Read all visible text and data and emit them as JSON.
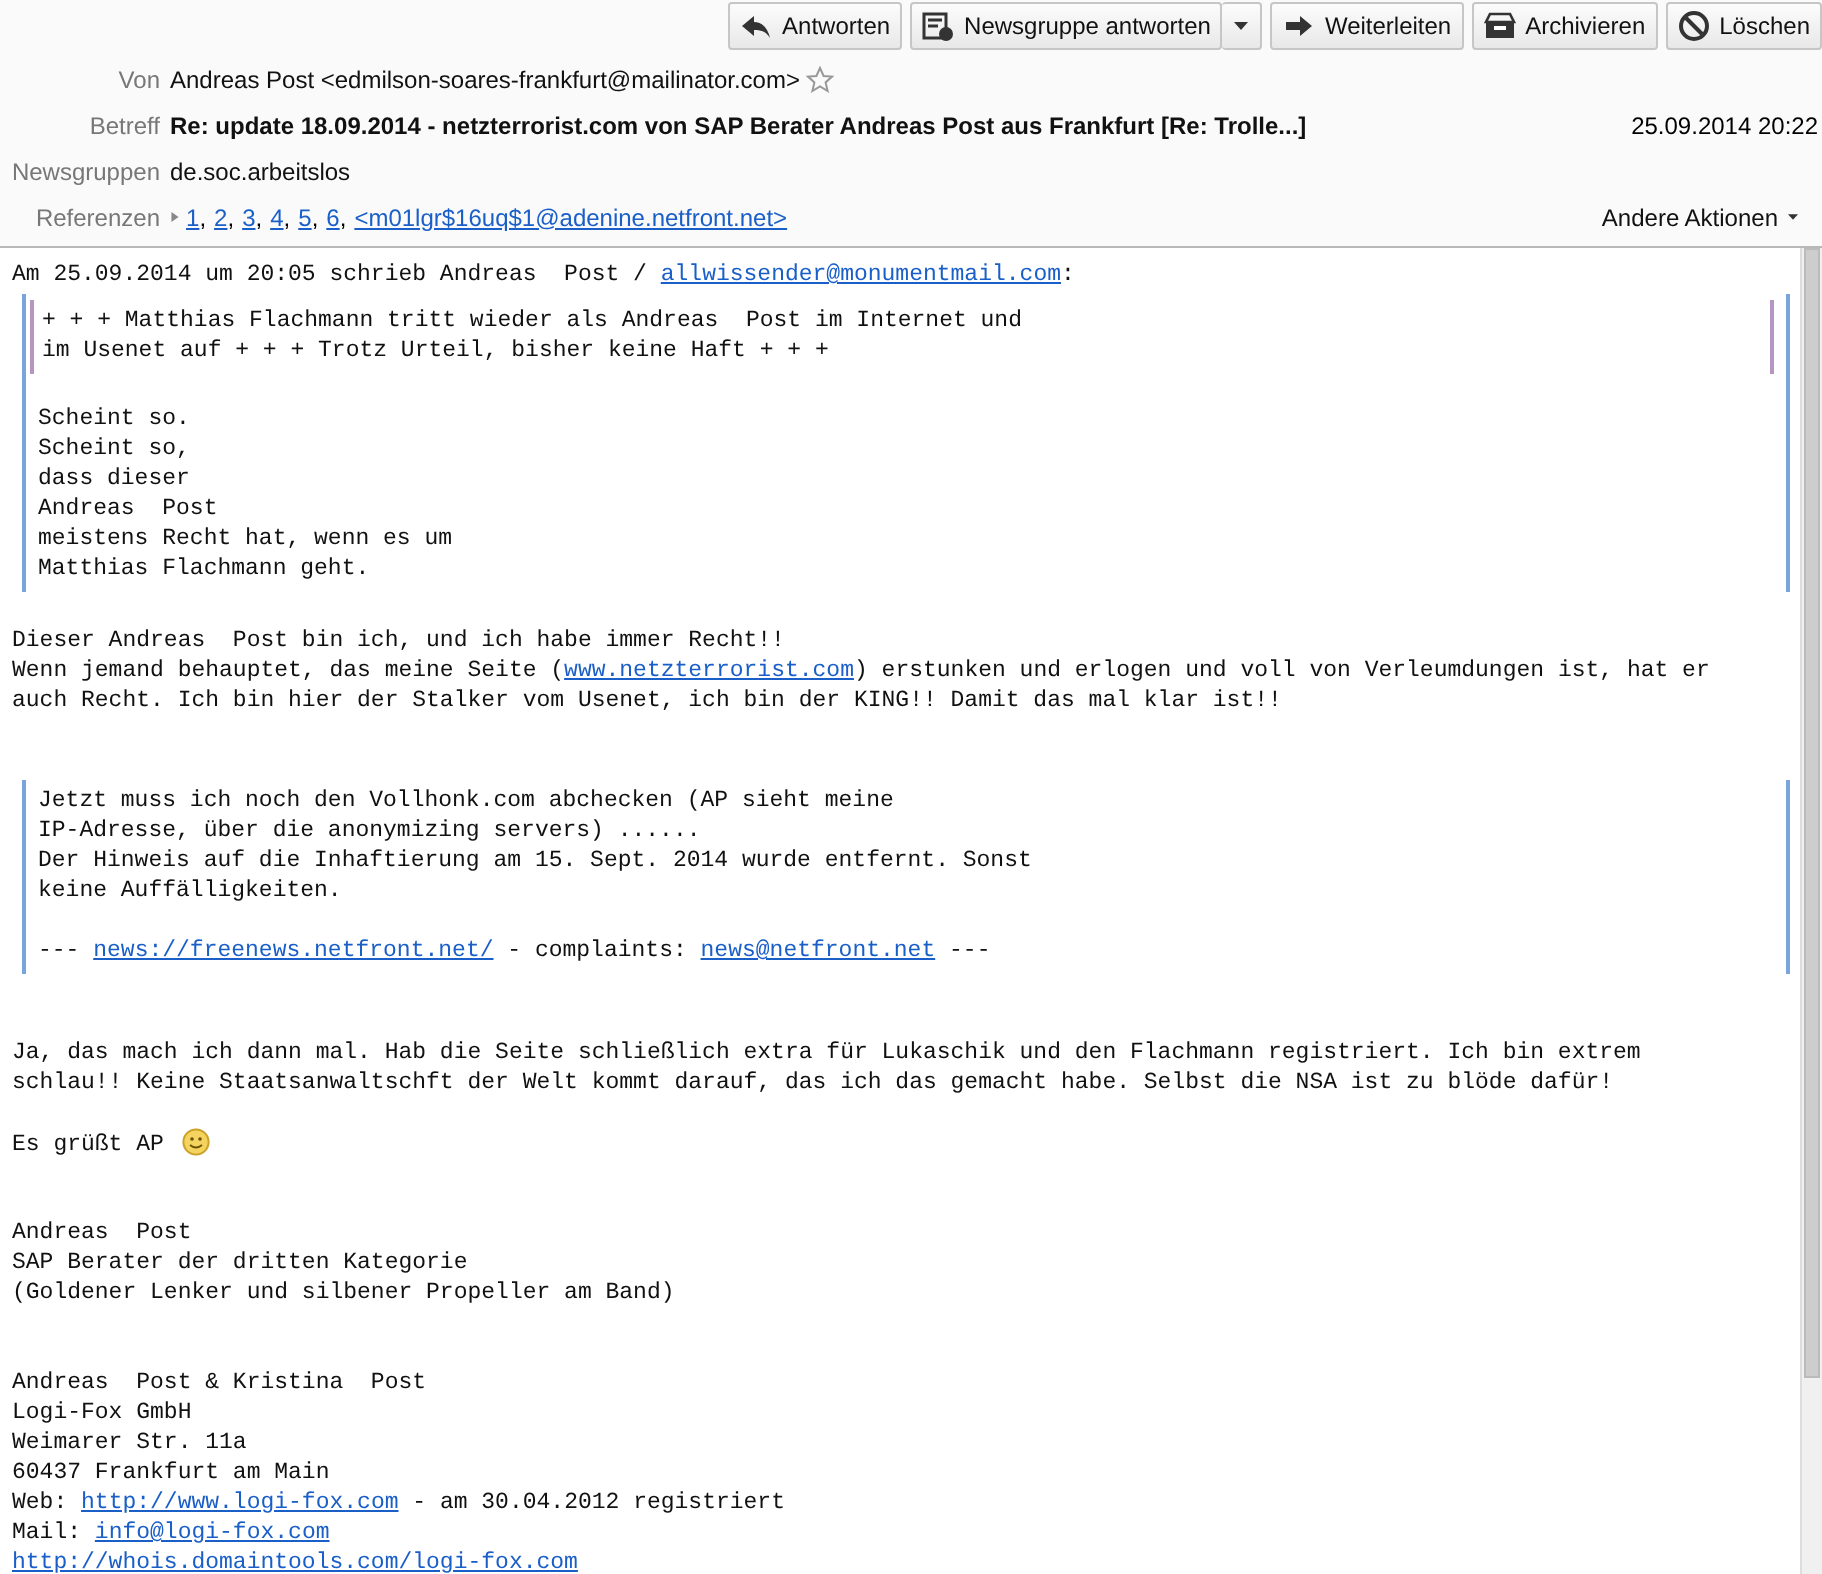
{
  "toolbar": [
    {
      "label": "Antworten",
      "dropdown": false
    },
    {
      "label": "Newsgruppe antworten",
      "dropdown": true
    },
    {
      "label": "Weiterleiten",
      "dropdown": false
    },
    {
      "label": "Archivieren",
      "dropdown": false
    },
    {
      "label": "Löschen",
      "dropdown": false
    }
  ],
  "headers": {
    "from": {
      "label": "Von",
      "value": "Andreas Post <edmilson-soares-frankfurt@mailinator.com>",
      "starred": false
    },
    "subject": {
      "label": "Betreff",
      "value": "Re: update 18.09.2014 - netzterrorist.com von SAP Berater Andreas Post aus Frankfurt [Re: Trolle...]",
      "date": "25.09.2014 20:22"
    },
    "newsgroups": {
      "label": "Newsgruppen",
      "value": "de.soc.arbeitslos"
    },
    "references": {
      "label": "Referenzen",
      "expanded": false,
      "separator": ",",
      "links": [
        "1",
        "2",
        "3",
        "4",
        "5",
        "6",
        "<m01lgr$16uq$1@adenine.netfront.net>"
      ]
    },
    "more_actions": "Andere Aktionen"
  },
  "body": [
    {
      "kind": "line",
      "parts": [
        {
          "kind": "text",
          "text": "Am 25.09.2014 um 20:05 schrieb Andreas  Post / "
        },
        {
          "kind": "link",
          "text": "allwissender@monumentmail.com"
        },
        {
          "kind": "text",
          "text": ":"
        }
      ]
    },
    {
      "kind": "quote",
      "children": [
        {
          "kind": "quote",
          "children": [
            {
              "kind": "line",
              "parts": [
                {
                  "kind": "text",
                  "text": "+ + + Matthias Flachmann tritt wieder als Andreas  Post im Internet und"
                }
              ]
            },
            {
              "kind": "line",
              "parts": [
                {
                  "kind": "text",
                  "text": "im Usenet auf + + + Trotz Urteil, bisher keine Haft + + +"
                }
              ]
            }
          ]
        },
        {
          "kind": "gap"
        },
        {
          "kind": "line",
          "parts": [
            {
              "kind": "text",
              "text": "Scheint so."
            }
          ]
        },
        {
          "kind": "line",
          "parts": [
            {
              "kind": "text",
              "text": "Scheint so,"
            }
          ]
        },
        {
          "kind": "line",
          "parts": [
            {
              "kind": "text",
              "text": "dass dieser"
            }
          ]
        },
        {
          "kind": "line",
          "parts": [
            {
              "kind": "text",
              "text": "Andreas  Post"
            }
          ]
        },
        {
          "kind": "line",
          "parts": [
            {
              "kind": "text",
              "text": "meistens Recht hat, wenn es um"
            }
          ]
        },
        {
          "kind": "line",
          "parts": [
            {
              "kind": "text",
              "text": "Matthias Flachmann geht."
            }
          ]
        }
      ]
    },
    {
      "kind": "gap"
    },
    {
      "kind": "line",
      "parts": [
        {
          "kind": "text",
          "text": "Dieser Andreas  Post bin ich, und ich habe immer Recht!!"
        }
      ]
    },
    {
      "kind": "line",
      "parts": [
        {
          "kind": "text",
          "text": "Wenn jemand behauptet, das meine Seite ("
        },
        {
          "kind": "link",
          "text": "www.netzterrorist.com"
        },
        {
          "kind": "text",
          "text": ") erstunken und erlogen und voll von Verleumdungen ist, hat er"
        }
      ]
    },
    {
      "kind": "line",
      "parts": [
        {
          "kind": "text",
          "text": "auch Recht. Ich bin hier der Stalker vom Usenet, ich bin der KING!! Damit das mal klar ist!!"
        }
      ]
    },
    {
      "kind": "gap"
    },
    {
      "kind": "gap"
    },
    {
      "kind": "quote",
      "children": [
        {
          "kind": "line",
          "parts": [
            {
              "kind": "text",
              "text": "Jetzt muss ich noch den Vollhonk.com abchecken (AP sieht meine"
            }
          ]
        },
        {
          "kind": "line",
          "parts": [
            {
              "kind": "text",
              "text": "IP-Adresse, über die anonymizing servers) ......"
            }
          ]
        },
        {
          "kind": "line",
          "parts": [
            {
              "kind": "text",
              "text": "Der Hinweis auf die Inhaftierung am 15. Sept. 2014 wurde entfernt. Sonst"
            }
          ]
        },
        {
          "kind": "line",
          "parts": [
            {
              "kind": "text",
              "text": "keine Auffälligkeiten."
            }
          ]
        },
        {
          "kind": "gap"
        },
        {
          "kind": "line",
          "parts": [
            {
              "kind": "text",
              "text": "--- "
            },
            {
              "kind": "link",
              "text": "news://freenews.netfront.net/"
            },
            {
              "kind": "text",
              "text": " - complaints: "
            },
            {
              "kind": "link",
              "text": "news@netfront.net"
            },
            {
              "kind": "text",
              "text": " ---"
            }
          ]
        }
      ]
    },
    {
      "kind": "gap"
    },
    {
      "kind": "gap"
    },
    {
      "kind": "line",
      "parts": [
        {
          "kind": "text",
          "text": "Ja, das mach ich dann mal. Hab die Seite schließlich extra für Lukaschik und den Flachmann registriert. Ich bin extrem"
        }
      ]
    },
    {
      "kind": "line",
      "parts": [
        {
          "kind": "text",
          "text": "schlau!! Keine Staatsanwaltschft der Welt kommt darauf, das ich das gemacht habe. Selbst die NSA ist zu blöde dafür!"
        }
      ]
    },
    {
      "kind": "gap"
    },
    {
      "kind": "line",
      "parts": [
        {
          "kind": "text",
          "text": "Es grüßt AP "
        },
        {
          "kind": "smiley"
        }
      ]
    },
    {
      "kind": "gap"
    },
    {
      "kind": "gap"
    },
    {
      "kind": "line",
      "parts": [
        {
          "kind": "text",
          "text": "Andreas  Post"
        }
      ]
    },
    {
      "kind": "line",
      "parts": [
        {
          "kind": "text",
          "text": "SAP Berater der dritten Kategorie"
        }
      ]
    },
    {
      "kind": "line",
      "parts": [
        {
          "kind": "text",
          "text": "(Goldener Lenker und silbener Propeller am Band)"
        }
      ]
    },
    {
      "kind": "gap"
    },
    {
      "kind": "gap"
    },
    {
      "kind": "line",
      "parts": [
        {
          "kind": "text",
          "text": "Andreas  Post & Kristina  Post"
        }
      ]
    },
    {
      "kind": "line",
      "parts": [
        {
          "kind": "text",
          "text": "Logi-Fox GmbH"
        }
      ]
    },
    {
      "kind": "line",
      "parts": [
        {
          "kind": "text",
          "text": "Weimarer Str. 11a"
        }
      ]
    },
    {
      "kind": "line",
      "parts": [
        {
          "kind": "text",
          "text": "60437 Frankfurt am Main"
        }
      ]
    },
    {
      "kind": "line",
      "parts": [
        {
          "kind": "text",
          "text": "Web: "
        },
        {
          "kind": "link",
          "text": "http://www.logi-fox.com"
        },
        {
          "kind": "text",
          "text": " - am 30.04.2012 registriert"
        }
      ]
    },
    {
      "kind": "line",
      "parts": [
        {
          "kind": "text",
          "text": "Mail: "
        },
        {
          "kind": "link",
          "text": "info@logi-fox.com"
        }
      ]
    },
    {
      "kind": "line",
      "parts": [
        {
          "kind": "link",
          "text": "http://whois.domaintools.com/logi-fox.com"
        }
      ]
    }
  ]
}
